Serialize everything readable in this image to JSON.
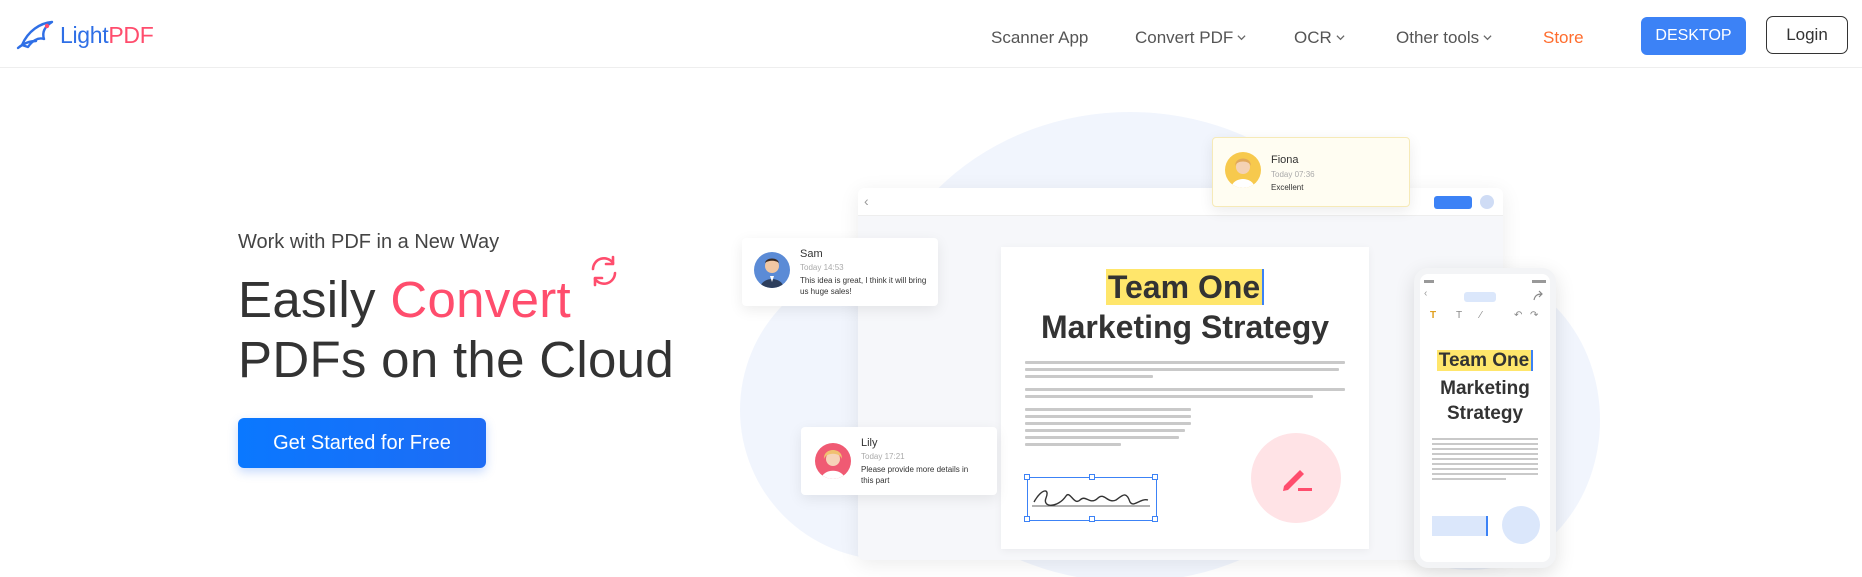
{
  "header": {
    "logo_light": "Light",
    "logo_pdf": "PDF",
    "nav": {
      "scanner": "Scanner App",
      "convert": "Convert PDF",
      "ocr": "OCR",
      "other": "Other tools",
      "store": "Store"
    },
    "desktop_button": "DESKTOP",
    "login_button": "Login"
  },
  "hero": {
    "subtitle": "Work with PDF in a New Way",
    "title_part1": "Easily ",
    "title_accent": "Convert",
    "title_line2": "PDFs on the Cloud",
    "cta": "Get Started for Free"
  },
  "illustration": {
    "doc_title_highlight": "Team One",
    "doc_title_line2": "Marketing Strategy",
    "phone_title_highlight": "Team One",
    "phone_title_rest": "Marketing Strategy",
    "comments": [
      {
        "name": "Fiona",
        "time": "Today 07:36",
        "text": "Excellent"
      },
      {
        "name": "Sam",
        "time": "Today 14:53",
        "text": "This idea is great, I think it will bring us huge sales!"
      },
      {
        "name": "Lily",
        "time": "Today 17:21",
        "text": "Please provide more details in this part"
      }
    ]
  },
  "colors": {
    "brand_blue": "#2f6fe6",
    "brand_pink": "#ff4d6d",
    "store_orange": "#ff6d2e",
    "cta_blue": "#0a78ff"
  },
  "icons": [
    "logo-icon",
    "chevron-down-icon",
    "convert-refresh-icon",
    "pen-icon",
    "back-icon",
    "share-icon"
  ]
}
